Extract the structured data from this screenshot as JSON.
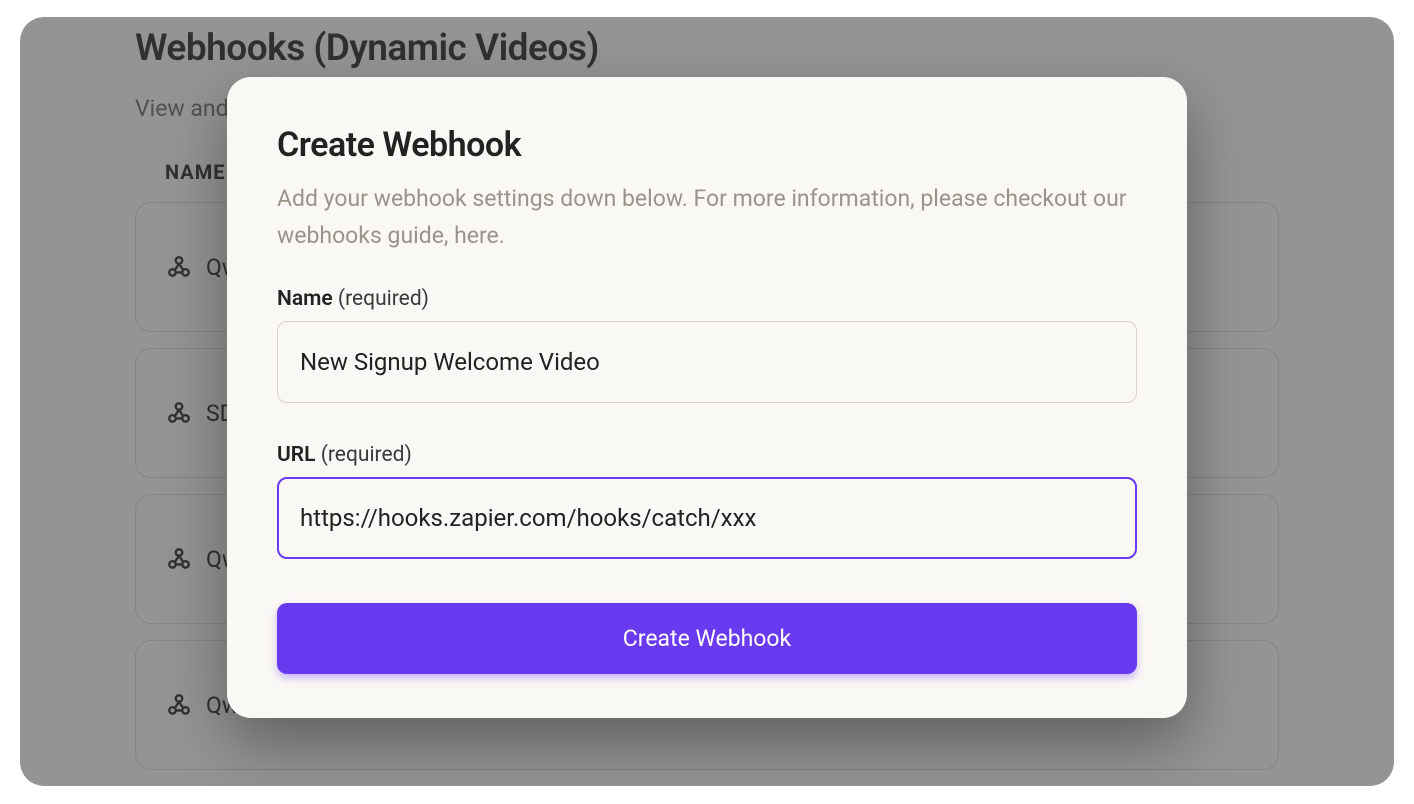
{
  "page": {
    "title": "Webhooks (Dynamic Videos)",
    "subtitle": "View and ",
    "table": {
      "header_name": "NAME"
    },
    "rows": [
      {
        "name": "Qw"
      },
      {
        "name": "SD"
      },
      {
        "name": "Qw"
      },
      {
        "name": "Qw"
      }
    ]
  },
  "modal": {
    "title": "Create Webhook",
    "subtitle": "Add your webhook settings down below. For more information, please checkout our webhooks guide, here.",
    "name_label": "Name",
    "name_required": " (required)",
    "name_value": "New Signup Welcome Video",
    "url_label": "URL",
    "url_required": " (required)",
    "url_value": "https://hooks.zapier.com/hooks/catch/xxx",
    "submit_label": "Create Webhook"
  }
}
